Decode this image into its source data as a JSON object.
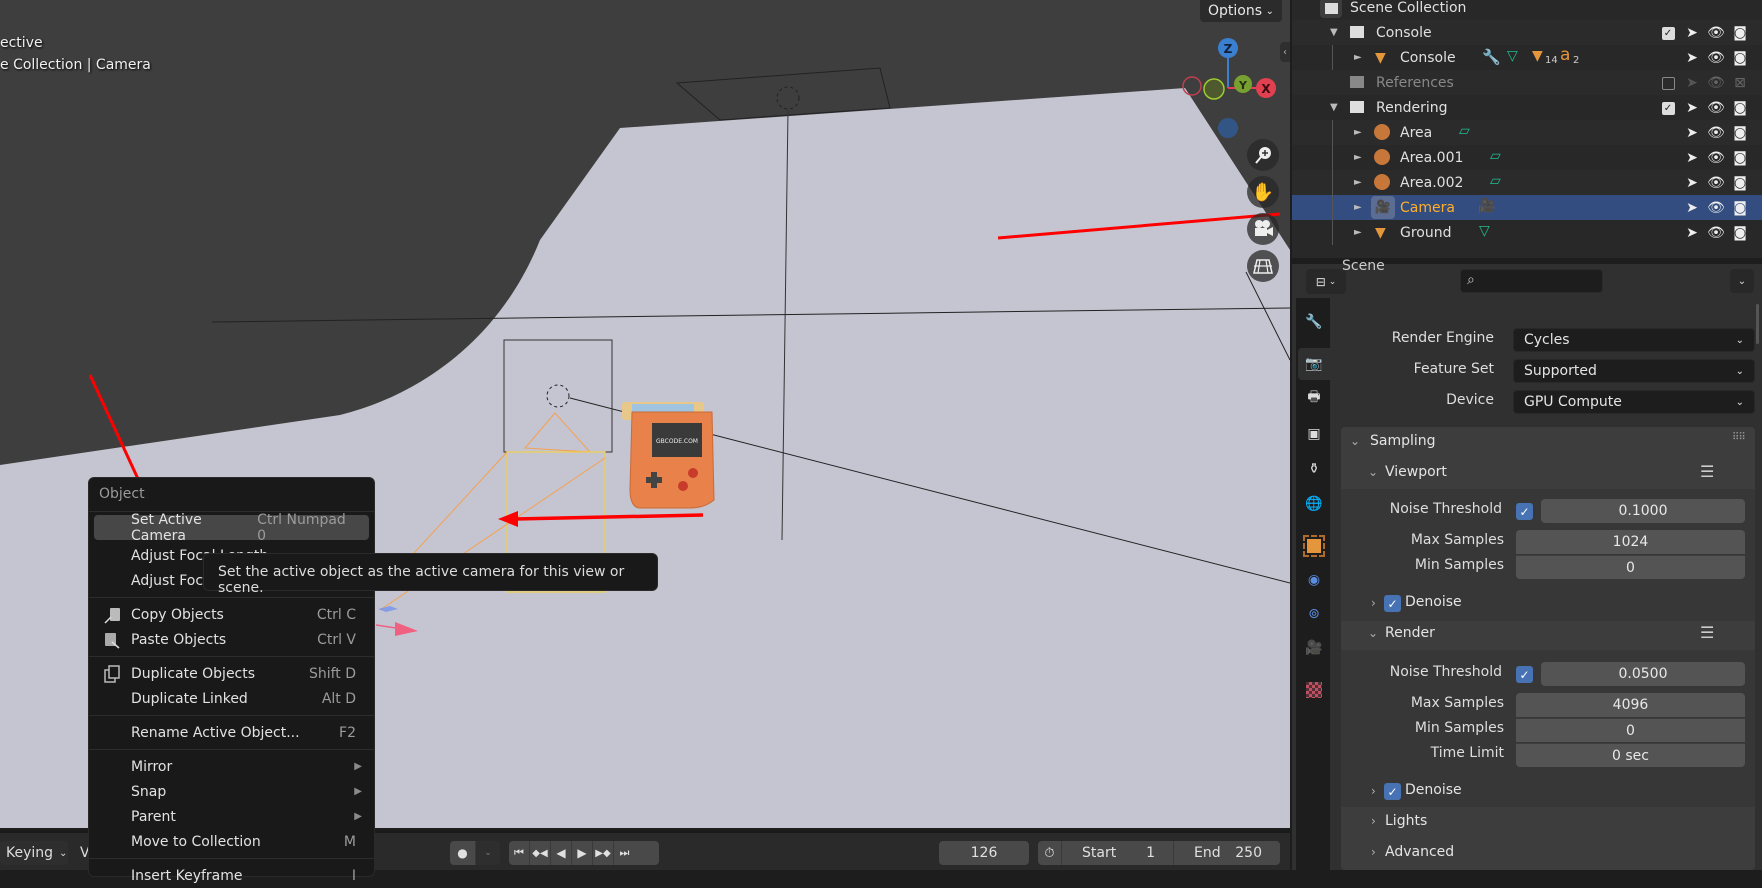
{
  "viewport": {
    "view_mode": "ective",
    "collection_path": "e Collection | Camera",
    "options_label": "Options",
    "gizmo_axes": [
      "Z",
      "Y",
      "X"
    ],
    "nav_buttons": [
      "zoom-icon",
      "pan-hand-icon",
      "camera-view-icon",
      "ortho-grid-icon"
    ],
    "product_label": "GBCODE.COM"
  },
  "context_menu": {
    "title": "Object",
    "items": [
      {
        "label": "Set Active Camera",
        "shortcut": "Ctrl Numpad 0",
        "highlighted": true
      },
      {
        "label": "Adjust Focal Length",
        "shortcut": ""
      },
      {
        "label": "Adjust Focus Distance",
        "shortcut": ""
      },
      {
        "label": "Copy Objects",
        "shortcut": "Ctrl C",
        "icon": "copy-icon"
      },
      {
        "label": "Paste Objects",
        "shortcut": "Ctrl V",
        "icon": "paste-icon"
      },
      {
        "label": "Duplicate Objects",
        "shortcut": "Shift D",
        "icon": "duplicate-icon"
      },
      {
        "label": "Duplicate Linked",
        "shortcut": "Alt D"
      },
      {
        "label": "Rename Active Object...",
        "shortcut": "F2"
      },
      {
        "label": "Mirror",
        "submenu": true
      },
      {
        "label": "Snap",
        "submenu": true
      },
      {
        "label": "Parent",
        "submenu": true
      },
      {
        "label": "Move to Collection",
        "shortcut": "M"
      },
      {
        "label": "Insert Keyframe",
        "shortcut": "I"
      }
    ]
  },
  "tooltip": {
    "text": "Set the active object as the active camera for this view or scene."
  },
  "timeline": {
    "keying_label": "Keying",
    "view_label": "V",
    "current_frame": "126",
    "start_label": "Start",
    "start_value": "1",
    "end_label": "End",
    "end_value": "250"
  },
  "outliner": {
    "rows": [
      {
        "label": "Scene Collection",
        "type": "scene-collection"
      },
      {
        "label": "Console",
        "type": "collection",
        "checked": true
      },
      {
        "label": "Console",
        "type": "mesh-object",
        "extras": [
          "modifier-wrench-icon",
          "mesh-data-icon",
          "14",
          "2"
        ]
      },
      {
        "label": "References",
        "type": "collection",
        "checked": false,
        "disabled": true
      },
      {
        "label": "Rendering",
        "type": "collection",
        "checked": true
      },
      {
        "label": "Area",
        "type": "light-object"
      },
      {
        "label": "Area.001",
        "type": "light-object"
      },
      {
        "label": "Area.002",
        "type": "light-object"
      },
      {
        "label": "Camera",
        "type": "camera-object",
        "selected": true
      },
      {
        "label": "Ground",
        "type": "mesh-object"
      }
    ],
    "sub_counts": {
      "materials": "14",
      "fonts": "2"
    }
  },
  "properties": {
    "search_placeholder": "",
    "section": "Scene",
    "render_engine_label": "Render Engine",
    "render_engine": "Cycles",
    "feature_set_label": "Feature Set",
    "feature_set": "Supported",
    "device_label": "Device",
    "device": "GPU Compute",
    "sampling": {
      "title": "Sampling",
      "viewport": {
        "title": "Viewport",
        "noise_threshold_label": "Noise Threshold",
        "noise_threshold_enabled": true,
        "noise_threshold": "0.1000",
        "max_samples_label": "Max Samples",
        "max_samples": "1024",
        "min_samples_label": "Min Samples",
        "min_samples": "0",
        "denoise_label": "Denoise",
        "denoise": true
      },
      "render": {
        "title": "Render",
        "noise_threshold_label": "Noise Threshold",
        "noise_threshold_enabled": true,
        "noise_threshold": "0.0500",
        "max_samples_label": "Max Samples",
        "max_samples": "4096",
        "min_samples_label": "Min Samples",
        "min_samples": "0",
        "time_limit_label": "Time Limit",
        "time_limit": "0 sec",
        "denoise_label": "Denoise",
        "denoise": true
      }
    },
    "lights_label": "Lights",
    "advanced_label": "Advanced"
  },
  "colors": {
    "accent_blue": "#4772b3",
    "selected_row": "#334d80",
    "object_orange": "#e4963c",
    "data_green": "#1fbf8f",
    "annotation_red": "#ff0000"
  }
}
